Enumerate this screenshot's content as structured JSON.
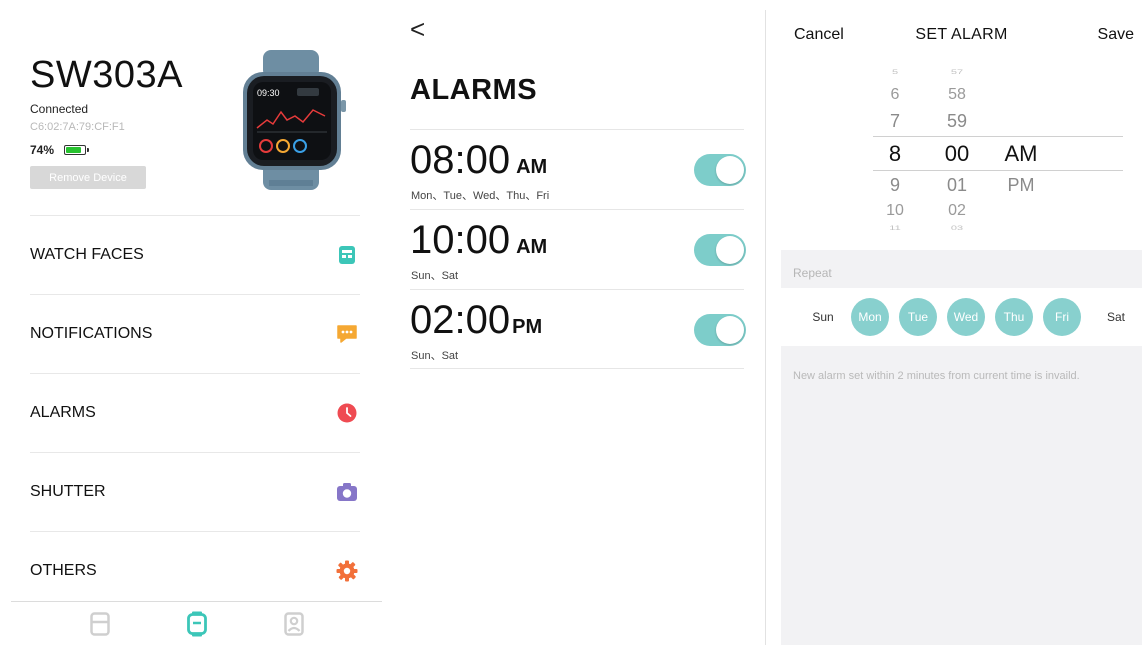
{
  "device": {
    "name": "SW303A",
    "status": "Connected",
    "mac": "C6:02:7A:79:CF:F1",
    "battery_text": "74%",
    "battery_level": 0.74,
    "remove_label": "Remove Device",
    "watch_time": "09:30"
  },
  "menu": {
    "items": [
      {
        "label": "WATCH FACES",
        "icon": "watch-face-icon",
        "color": "#3cc6b8"
      },
      {
        "label": "NOTIFICATIONS",
        "icon": "message-icon",
        "color": "#f5a833"
      },
      {
        "label": "ALARMS",
        "icon": "clock-icon",
        "color": "#ef4b52"
      },
      {
        "label": "SHUTTER",
        "icon": "camera-icon",
        "color": "#8676c8"
      },
      {
        "label": "OTHERS",
        "icon": "gear-icon",
        "color": "#f2703a"
      }
    ]
  },
  "tabbar": {
    "tabs": [
      {
        "icon": "dashboard-icon",
        "active": false
      },
      {
        "icon": "watch-icon",
        "active": true
      },
      {
        "icon": "profile-icon",
        "active": false
      }
    ],
    "active_color": "#3cc6b8",
    "inactive_color": "#cfcfcf"
  },
  "alarms": {
    "back": "<",
    "title": "ALARMS",
    "items": [
      {
        "time": "08:00",
        "ampm": "AM",
        "days": "Mon、Tue、Wed、Thu、Fri",
        "enabled": true
      },
      {
        "time": "10:00",
        "ampm": "AM",
        "days": "Sun、Sat",
        "enabled": true
      },
      {
        "time": "02:00",
        "ampm": "PM",
        "days": "Sun、Sat",
        "enabled": true
      }
    ],
    "toggle_color": "#7dcdca"
  },
  "set_alarm": {
    "cancel": "Cancel",
    "title": "SET ALARM",
    "save": "Save",
    "picker": {
      "hours": [
        "5",
        "6",
        "7",
        "8",
        "9",
        "10",
        "11"
      ],
      "minutes": [
        "57",
        "58",
        "59",
        "00",
        "01",
        "02",
        "03"
      ],
      "periods": [
        "AM",
        "PM"
      ],
      "selected": {
        "hour": "8",
        "minute": "00",
        "period": "AM"
      }
    },
    "repeat_label": "Repeat",
    "days": [
      {
        "label": "Sun",
        "on": false
      },
      {
        "label": "Mon",
        "on": true
      },
      {
        "label": "Tue",
        "on": true
      },
      {
        "label": "Wed",
        "on": true
      },
      {
        "label": "Thu",
        "on": true
      },
      {
        "label": "Fri",
        "on": true
      },
      {
        "label": "Sat",
        "on": false
      }
    ],
    "note": "New alarm set within 2 minutes from current time is invaild."
  }
}
